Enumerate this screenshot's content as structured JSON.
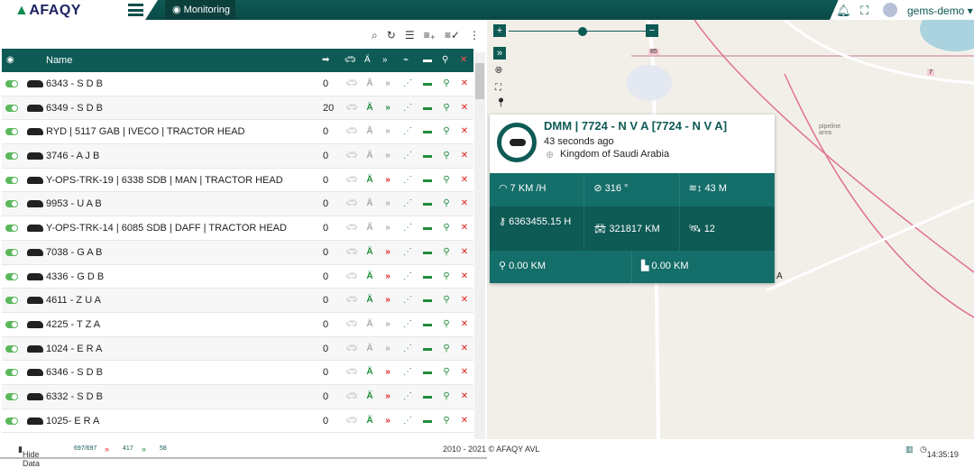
{
  "header": {
    "logo": "AFAQY",
    "tab": "Monitoring",
    "user": "gems-demo"
  },
  "table": {
    "name_header": "Name",
    "rows": [
      {
        "name": "6343 - S D B",
        "speed": "0",
        "antenna": "off",
        "move": "off"
      },
      {
        "name": "6349 - S D B",
        "speed": "20",
        "antenna": "on",
        "move": "green"
      },
      {
        "name": "RYD | 5117 GAB | IVECO | TRACTOR HEAD",
        "speed": "0",
        "antenna": "off",
        "move": "off"
      },
      {
        "name": "3746 - A J B",
        "speed": "0",
        "antenna": "off",
        "move": "off"
      },
      {
        "name": "Y-OPS-TRK-19 | 6338 SDB | MAN | TRACTOR HEAD",
        "speed": "0",
        "antenna": "on",
        "move": "red"
      },
      {
        "name": "9953 - U A B",
        "speed": "0",
        "antenna": "off",
        "move": "off"
      },
      {
        "name": "Y-OPS-TRK-14 | 6085 SDB | DAFF | TRACTOR HEAD",
        "speed": "0",
        "antenna": "off",
        "move": "off"
      },
      {
        "name": "7038 - G A B",
        "speed": "0",
        "antenna": "on",
        "move": "red"
      },
      {
        "name": "4336 - G D B",
        "speed": "0",
        "antenna": "on",
        "move": "red"
      },
      {
        "name": "4611 - Z U A",
        "speed": "0",
        "antenna": "on",
        "move": "red"
      },
      {
        "name": "4225 - T Z A",
        "speed": "0",
        "antenna": "off",
        "move": "off"
      },
      {
        "name": "1024 - E R A",
        "speed": "0",
        "antenna": "off",
        "move": "off"
      },
      {
        "name": "6346 - S D B",
        "speed": "0",
        "antenna": "on",
        "move": "red"
      },
      {
        "name": "6332 - S D B",
        "speed": "0",
        "antenna": "on",
        "move": "red"
      },
      {
        "name": "1025- E R A",
        "speed": "0",
        "antenna": "on",
        "move": "red"
      }
    ]
  },
  "card": {
    "title": "DMM | 7724 - N V A [7724 - N V A]",
    "time": "43 seconds ago",
    "location": "Kingdom of Saudi Arabia",
    "speed": "7 KM /H",
    "heading": "316 °",
    "altitude": "43 M",
    "engine_hours": "6363455.15 H",
    "odometer": "321817 KM",
    "satellites": "12",
    "distance1": "0.00 KM",
    "distance2": "0.00 KM"
  },
  "map": {
    "road1": "85",
    "road2": "7",
    "area": "pipeline area",
    "label_a": "A"
  },
  "footer": {
    "hide_data": "Hide Data",
    "total": "697/697",
    "red_count": "417",
    "green_count": "58",
    "copyright": "2010 - 2021 © AFAQY AVL",
    "time": "14:35:19"
  },
  "colors": {
    "primary": "#0e5a55",
    "green": "#1e8c3a",
    "red": "#e02020"
  }
}
